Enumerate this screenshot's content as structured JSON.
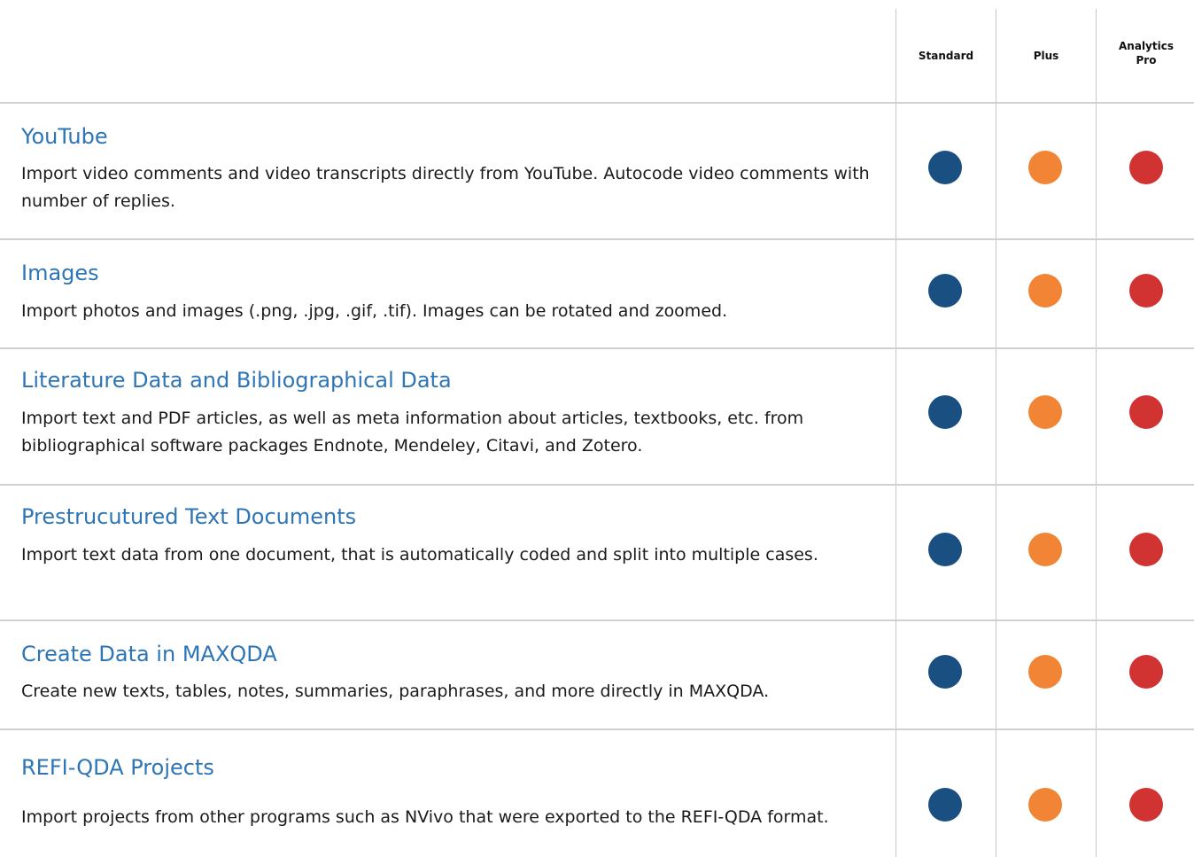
{
  "header": {
    "columns": [
      {
        "label": "Standard"
      },
      {
        "label": "Plus"
      },
      {
        "label": "Analytics\nPro"
      }
    ]
  },
  "colors": {
    "standard": "#1a4f82",
    "plus": "#f28535",
    "analytics_pro": "#d13232",
    "title": "#2e75b6"
  },
  "rows": [
    {
      "title": "YouTube",
      "description": "Import video comments and video transcripts directly from YouTube. Autocode video comments with number of replies.",
      "standard": true,
      "plus": true,
      "analytics_pro": true
    },
    {
      "title": "Images",
      "description": "Import photos and images (.png, .jpg, .gif, .tif). Images can be rotated and zoomed.",
      "standard": true,
      "plus": true,
      "analytics_pro": true
    },
    {
      "title": "Literature Data and Bibliographical Data",
      "description": "Import text and PDF articles, as well as meta information about articles, textbooks, etc. from bibliographical software packages Endnote, Mendeley, Citavi, and Zotero.",
      "standard": true,
      "plus": true,
      "analytics_pro": true
    },
    {
      "title": "Prestrucutured Text Documents",
      "description": "Import text data from one document, that is automatically coded and split into multiple cases.",
      "standard": true,
      "plus": true,
      "analytics_pro": true
    },
    {
      "title": "Create Data in MAXQDA",
      "description": "Create new texts, tables, notes, summaries, paraphrases, and more directly in MAXQDA.",
      "standard": true,
      "plus": true,
      "analytics_pro": true
    },
    {
      "title": "REFI-QDA Projects",
      "description": "Import projects from other programs such as NVivo that were exported to the REFI-QDA format.",
      "standard": true,
      "plus": true,
      "analytics_pro": true
    }
  ]
}
